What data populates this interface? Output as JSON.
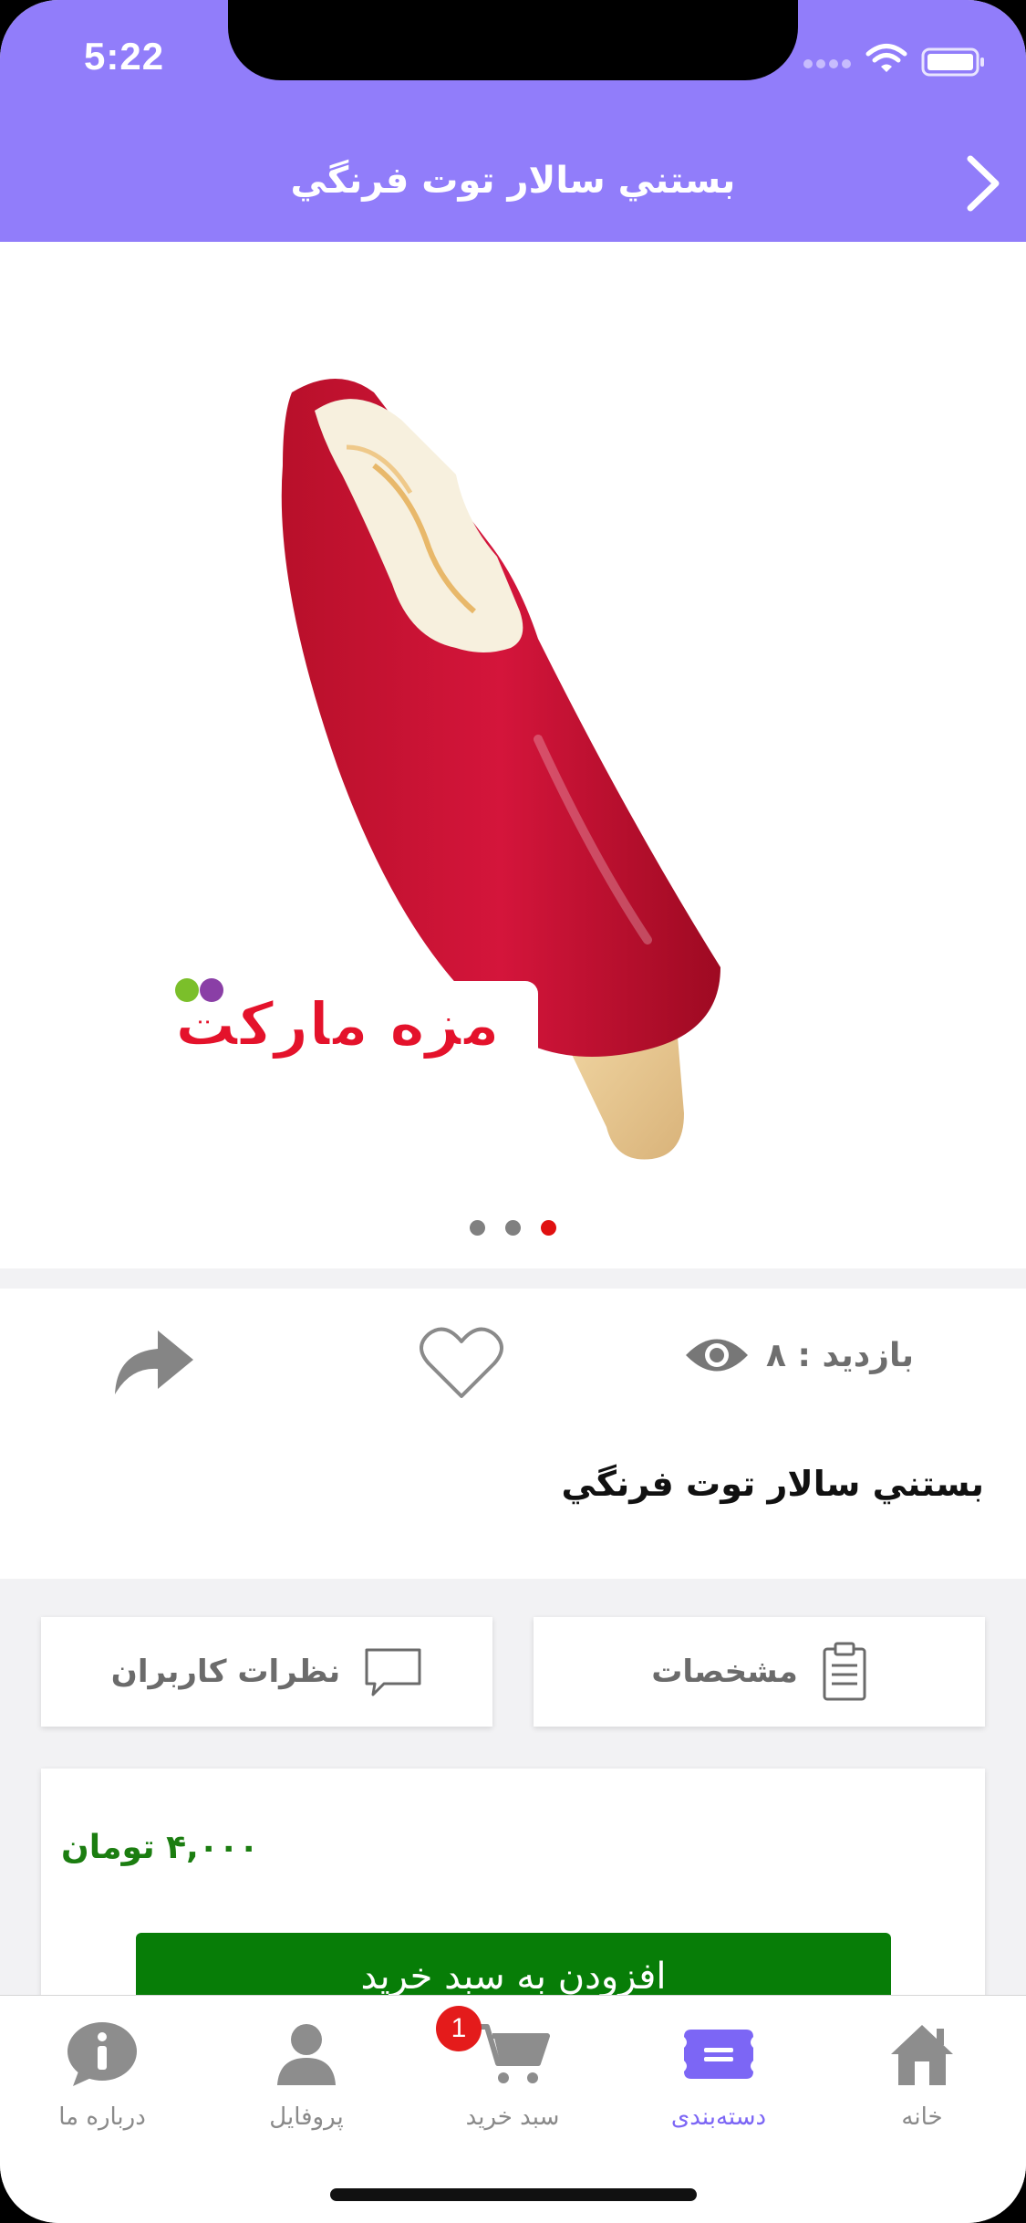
{
  "status_bar": {
    "time": "5:22"
  },
  "header": {
    "title": "بستني سالار توت فرنگي"
  },
  "gallery": {
    "brand_logo_text": "مزه مارکت",
    "dots": 3,
    "active_dot": 3
  },
  "info": {
    "views_label": "بازدید : ۸",
    "product_name": "بستني سالار توت فرنگي"
  },
  "tabs": {
    "specs": "مشخصات",
    "comments": "نظرات کاربران"
  },
  "price_card": {
    "price": "۴,۰۰۰ تومان",
    "add_to_cart": "افزودن به سبد خرید"
  },
  "bottom_nav": {
    "home": "خانه",
    "categories": "دسته‌بندی",
    "cart": "سبد خرید",
    "profile": "پروفایل",
    "about": "درباره ما",
    "cart_badge": "1",
    "active": "categories"
  },
  "colors": {
    "header": "#917dfa",
    "accent": "#7c66f5",
    "price": "#1b7d10",
    "add_button": "#077d07",
    "badge": "#e41b1b"
  }
}
